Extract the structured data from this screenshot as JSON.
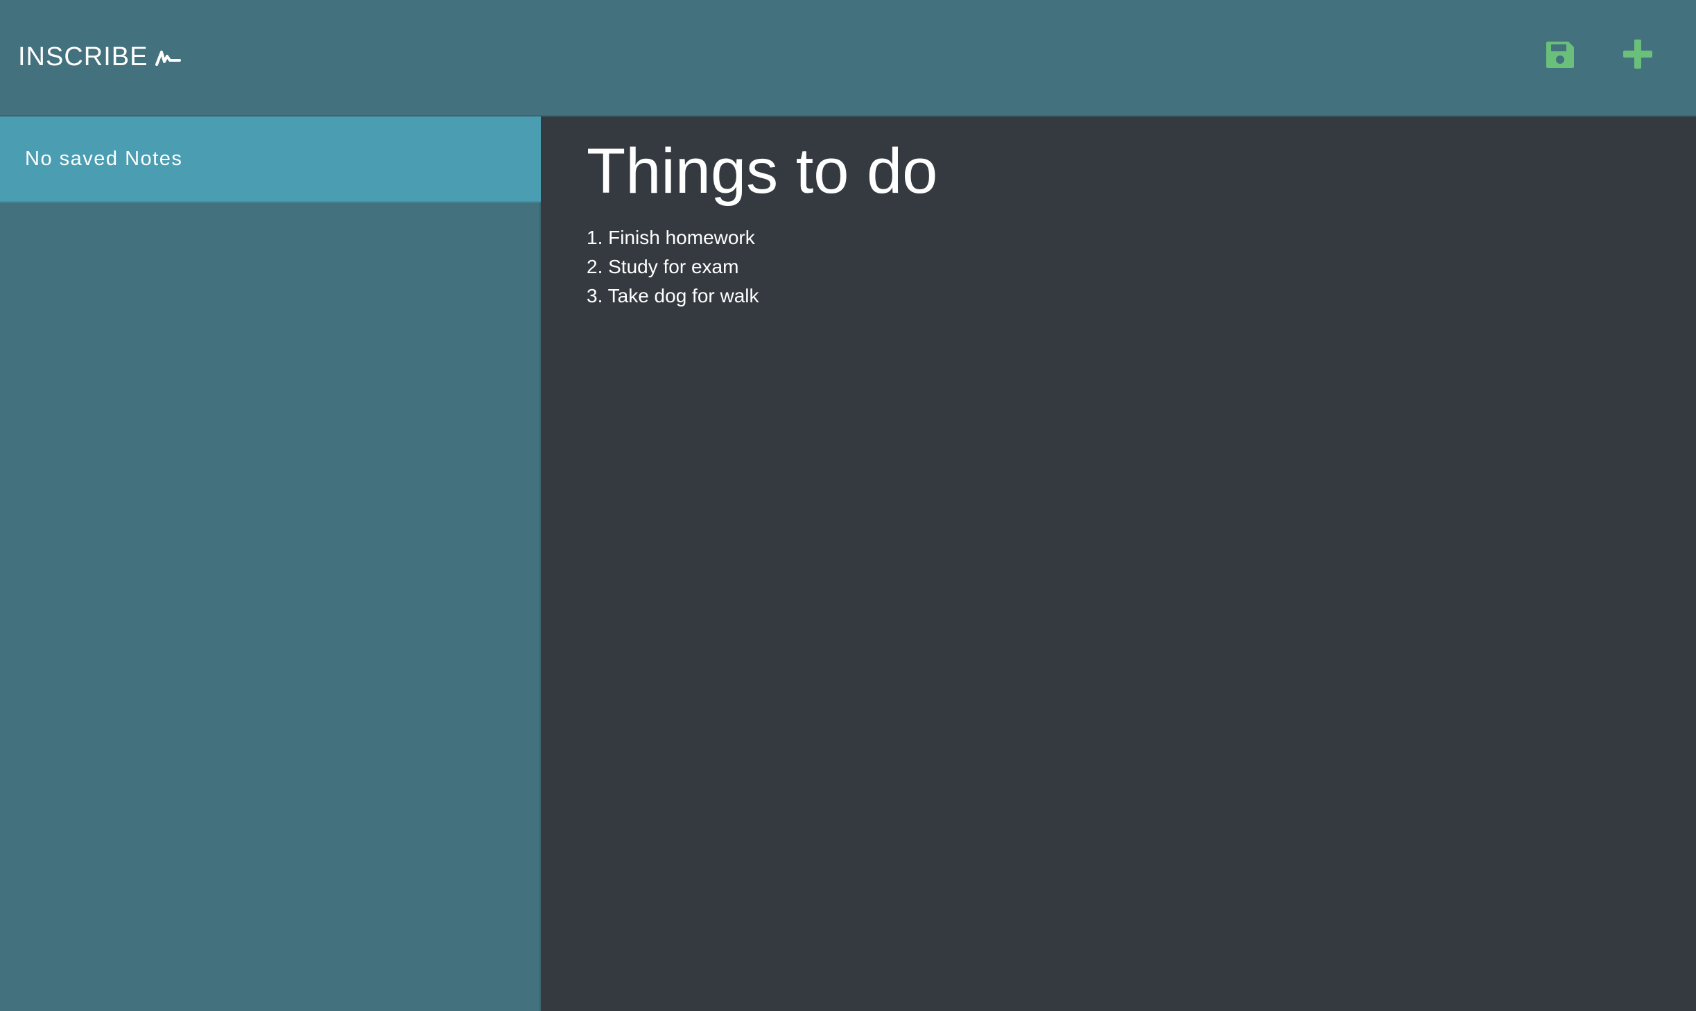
{
  "navbar": {
    "brand": "INSCRIBE",
    "brand_icon": "signature-icon",
    "save_icon": "floppy-disk-icon",
    "new_icon": "plus-icon",
    "accent_color": "#6abf7b"
  },
  "sidebar": {
    "empty_message": "No saved Notes"
  },
  "editor": {
    "title": "Things to do",
    "lines": [
      "1. Finish homework",
      "2. Study for exam",
      "3. Take dog for walk"
    ]
  },
  "colors": {
    "navbar_bg": "#43717e",
    "sidebar_item_bg": "#4b9db2",
    "editor_bg": "#343a40",
    "text": "#ffffff"
  }
}
